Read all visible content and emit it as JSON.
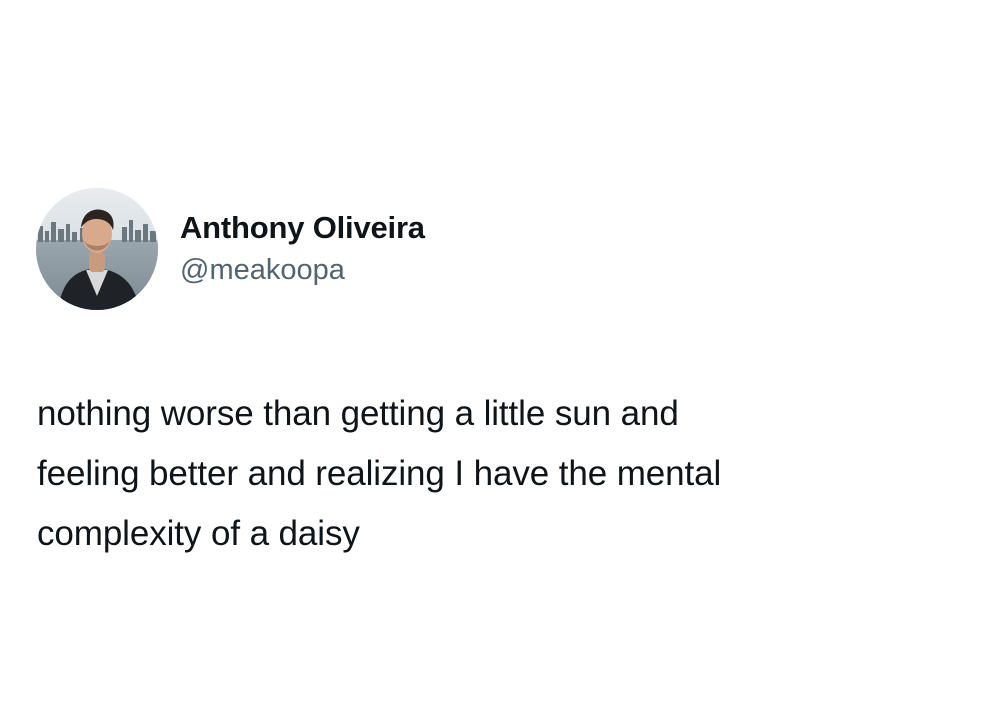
{
  "author": {
    "display_name": "Anthony Oliveira",
    "handle": "@meakoopa",
    "avatar_icon": "profile-photo"
  },
  "tweet": {
    "lines": [
      "nothing worse than getting a little sun and",
      "feeling better and realizing I have the mental",
      "complexity of a daisy"
    ]
  },
  "colors": {
    "background": "#ffffff",
    "text_primary": "#0f1419",
    "text_secondary": "#536471"
  }
}
